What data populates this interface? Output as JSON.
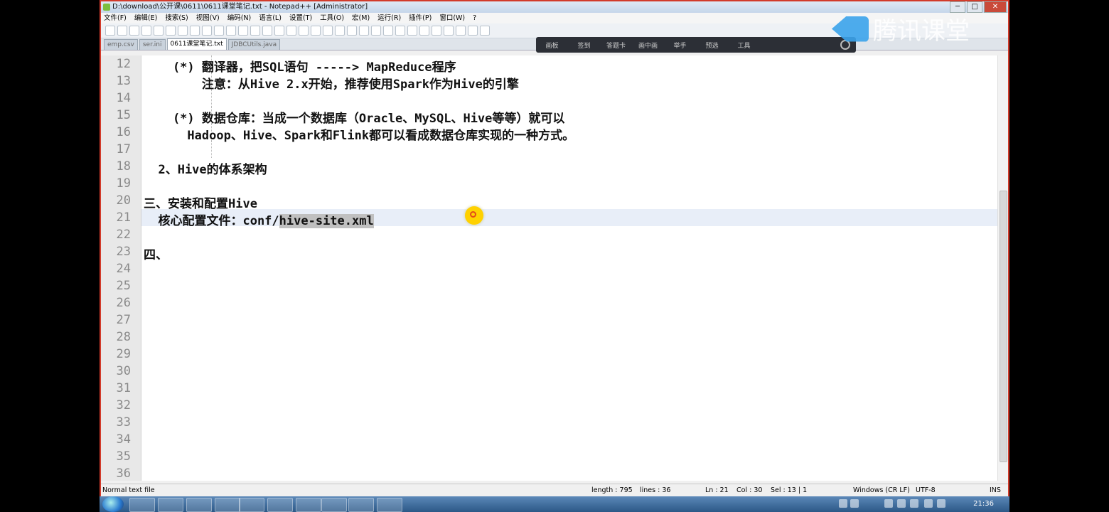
{
  "window": {
    "title": "D:\\download\\公开课\\0611\\0611课堂笔记.txt - Notepad++ [Administrator]",
    "controls": [
      "─",
      "□",
      "✕"
    ]
  },
  "menu": [
    "文件(F)",
    "编辑(E)",
    "搜索(S)",
    "视图(V)",
    "编码(N)",
    "语言(L)",
    "设置(T)",
    "工具(O)",
    "宏(M)",
    "运行(R)",
    "插件(P)",
    "窗口(W)",
    "?"
  ],
  "tabs": [
    {
      "label": "emp.csv"
    },
    {
      "label": "ser.ini"
    },
    {
      "label": "0611课堂笔记.txt",
      "active": true
    },
    {
      "label": "JDBCUtils.java"
    }
  ],
  "overlay_toolbar": [
    "画板",
    "签到",
    "答题卡",
    "画中画",
    "举手",
    "预选",
    "工具"
  ],
  "brand": "腾讯课堂",
  "editor": {
    "lines": [
      {
        "n": "12",
        "text": "    (*) 翻译器，把SQL语句 -----> MapReduce程序",
        "indent": 2
      },
      {
        "n": "13",
        "text": "        注意：从Hive 2.x开始，推荐使用Spark作为Hive的引擎",
        "indent": 2
      },
      {
        "n": "14",
        "text": "",
        "indent": 2
      },
      {
        "n": "15",
        "text": "    (*) 数据仓库：当成一个数据库（Oracle、MySQL、Hive等等）就可以",
        "indent": 2
      },
      {
        "n": "16",
        "text": "      Hadoop、Hive、Spark和Flink都可以看成数据仓库实现的一种方式。",
        "indent": 2
      },
      {
        "n": "17",
        "text": "",
        "indent": 2
      },
      {
        "n": "18",
        "text": "  2、Hive的体系架构",
        "indent": 0
      },
      {
        "n": "19",
        "text": "",
        "indent": 0
      },
      {
        "n": "20",
        "text": "三、安装和配置Hive",
        "indent": 0
      },
      {
        "n": "21",
        "pre": "  核心配置文件：conf/",
        "sel": "hive-site.xml",
        "post": "",
        "indent": 0
      },
      {
        "n": "22",
        "text": "",
        "indent": 0
      },
      {
        "n": "23",
        "text": "四、",
        "indent": 0
      },
      {
        "n": "24",
        "text": ""
      },
      {
        "n": "25",
        "text": ""
      },
      {
        "n": "26",
        "text": ""
      },
      {
        "n": "27",
        "text": ""
      },
      {
        "n": "28",
        "text": ""
      },
      {
        "n": "29",
        "text": ""
      },
      {
        "n": "30",
        "text": ""
      },
      {
        "n": "31",
        "text": ""
      },
      {
        "n": "32",
        "text": ""
      },
      {
        "n": "33",
        "text": ""
      },
      {
        "n": "34",
        "text": ""
      },
      {
        "n": "35",
        "text": ""
      },
      {
        "n": "36",
        "text": ""
      }
    ]
  },
  "status": {
    "type": "Normal text file",
    "length": "length : 795",
    "lines": "lines : 36",
    "ln": "Ln : 21",
    "col": "Col : 30",
    "sel": "Sel : 13 | 1",
    "eol": "Windows (CR LF)",
    "encoding": "UTF-8",
    "mode": "INS"
  },
  "taskbar": {
    "clock": "21:36"
  }
}
